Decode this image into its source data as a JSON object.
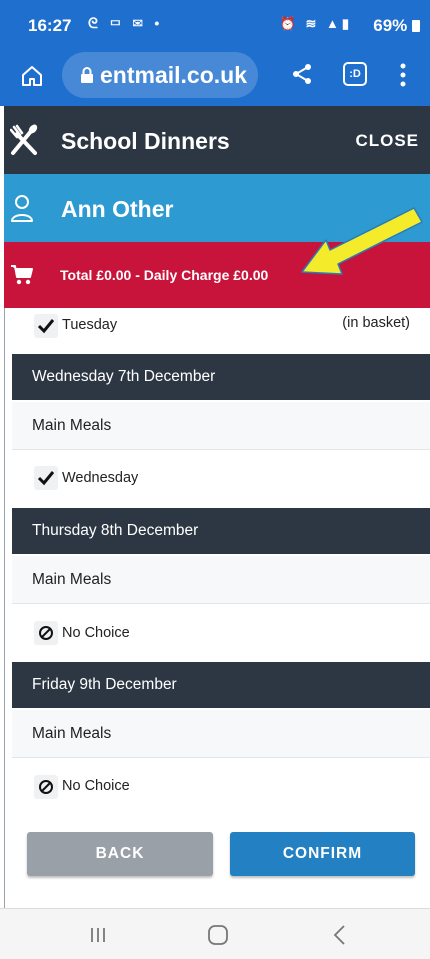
{
  "status_bar": {
    "time": "16:27",
    "battery": "69%"
  },
  "browser": {
    "url": "entmail.co.uk"
  },
  "app": {
    "title": "School Dinners",
    "close_label": "CLOSE"
  },
  "user": {
    "name": "Ann Other"
  },
  "basket": {
    "total_text": "Total £0.00 - Daily Charge £0.00"
  },
  "tuesday_item": {
    "label": "Tuesday",
    "status": "(in basket)"
  },
  "days": [
    {
      "header": "Wednesday 7th December",
      "section": "Main Meals",
      "choice": "Wednesday",
      "choice_icon": "checkmark-icon"
    },
    {
      "header": "Thursday 8th December",
      "section": "Main Meals",
      "choice": "No Choice",
      "choice_icon": "no-choice-icon"
    },
    {
      "header": "Friday 9th December",
      "section": "Main Meals",
      "choice": "No Choice",
      "choice_icon": "no-choice-icon"
    }
  ],
  "actions": {
    "back_label": "BACK",
    "confirm_label": "CONFIRM"
  },
  "colors": {
    "browser_bar": "#1f6fcf",
    "app_header": "#2d3743",
    "user_bar": "#2d9ad2",
    "total_bar": "#c8133a",
    "confirm": "#2381c3",
    "back": "#9aa0a7",
    "annotation_arrow": "#f4ec2a"
  }
}
